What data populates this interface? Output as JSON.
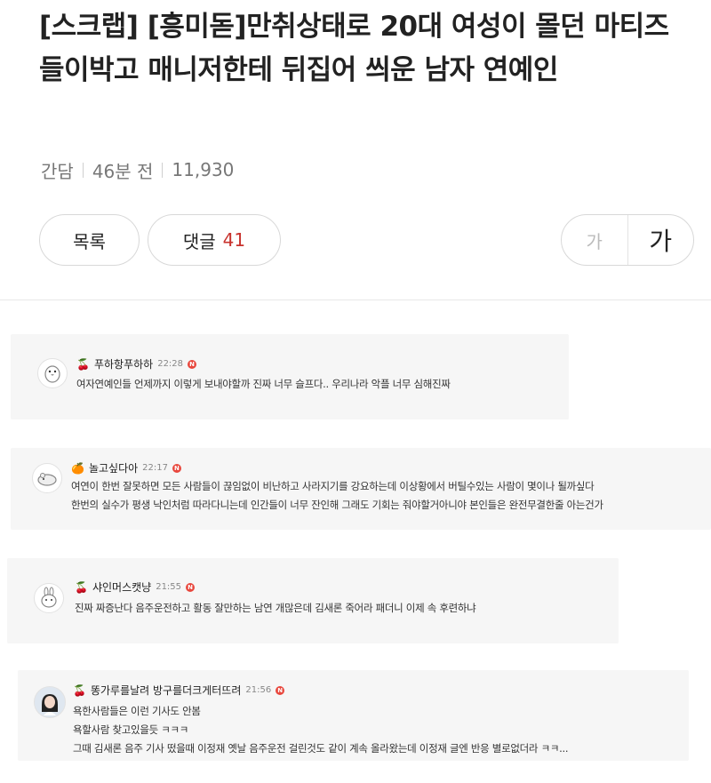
{
  "post": {
    "title": "[스크랩] [흥미돋]만취상태로 20대 여성이 몰던 마티즈 들이박고 매니저한테 뒤집어 씌운 남자 연예인",
    "category": "간담",
    "time_ago": "46분 전",
    "views": "11,930"
  },
  "toolbar": {
    "list_label": "목록",
    "comments_label": "댓글",
    "comments_count": "41",
    "font_small": "가",
    "font_large": "가"
  },
  "comments": [
    {
      "badge_icon": "cherry-icon",
      "nickname": "푸하항푸하하",
      "time": "22:28",
      "new_badge": "N",
      "lines": [
        "여자연예인들 언제까지 이렇게 보내야할까 진짜 너무 슬프다.. 우리나라 악플 너무 심해진짜"
      ]
    },
    {
      "badge_icon": "tangerine-icon",
      "nickname": "놀고싶다아",
      "time": "22:17",
      "new_badge": "N",
      "lines": [
        "여연이 한번 잘못하면 모든 사람들이 끊임없이 비난하고 사라지기를 강요하는데 이상황에서 버틸수있는 사람이 몇이나 될까싶다",
        "한번의 실수가 평생 낙인처럼 따라다니는데 인간들이 너무 잔인해 그래도 기회는 줘야할거아니야 본인들은 완전무결한줄 아는건가"
      ]
    },
    {
      "badge_icon": "cherry-icon",
      "nickname": "샤인머스캣냥",
      "time": "21:55",
      "new_badge": "N",
      "lines": [
        "진짜 짜증난다 음주운전하고 활동 잘만하는 남연 개많은데 김새론 죽어라 패더니 이제 속 후련하냐"
      ]
    },
    {
      "badge_icon": "cherry-icon",
      "nickname": "똥가루를날려 방구를더크게터뜨려",
      "time": "21:56",
      "new_badge": "N",
      "lines": [
        "욕한사람들은 이런 기사도 안봄",
        "욕할사람 찾고있을듯 ㅋㅋㅋ",
        "그때 김새론 음주 기사 떴을때 이정재 옛날 음주운전 걸린것도 같이 계속 올라왔는데 이정재 글엔 반응 별로없더라 ㅋㅋ..."
      ]
    }
  ]
}
